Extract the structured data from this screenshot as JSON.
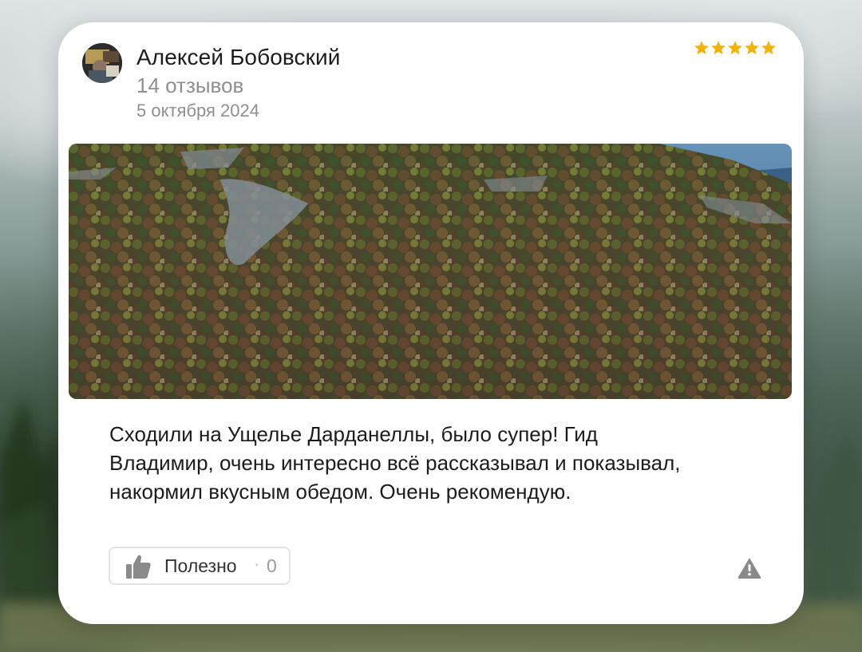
{
  "review": {
    "author_name": "Алексей Бобовский",
    "review_count": "14 отзывов",
    "date": "5 октября 2024",
    "rating": 5,
    "text": "Сходили на Ущелье Дарданеллы, было супер! Гид Владимир, очень интересно всё рассказывал и показывал, накормил вкусным обедом. Очень рекомендую."
  },
  "actions": {
    "useful_label": "Полезно",
    "useful_separator": "·",
    "useful_count": "0"
  },
  "icons": {
    "avatar": "avatar",
    "star": "star-icon",
    "thumb": "thumbs-up-icon",
    "report": "warning-icon"
  },
  "colors": {
    "star": "#f5b300",
    "text_primary": "#1c1c1c",
    "text_secondary": "#8f8f8f",
    "icon_gray": "#8a8a8a"
  }
}
